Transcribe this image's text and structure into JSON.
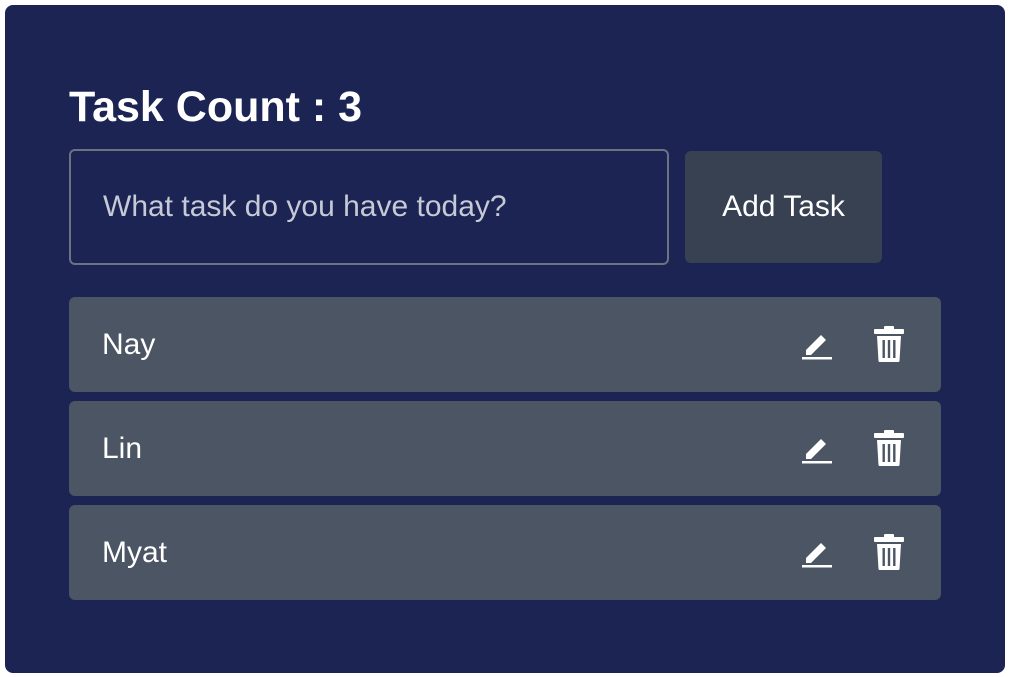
{
  "header": {
    "title": "Task Count : 3"
  },
  "form": {
    "input_value": "",
    "placeholder": "What task do you have today?",
    "add_label": "Add Task"
  },
  "tasks": [
    {
      "name": "Nay"
    },
    {
      "name": "Lin"
    },
    {
      "name": "Myat"
    }
  ],
  "icons": {
    "edit": "pencil-edit-icon",
    "delete": "trash-icon"
  },
  "colors": {
    "card_background": "#1b2453",
    "task_row": "#4b5563",
    "add_button": "#374151",
    "input_border": "#6b7280",
    "text": "#ffffff"
  }
}
